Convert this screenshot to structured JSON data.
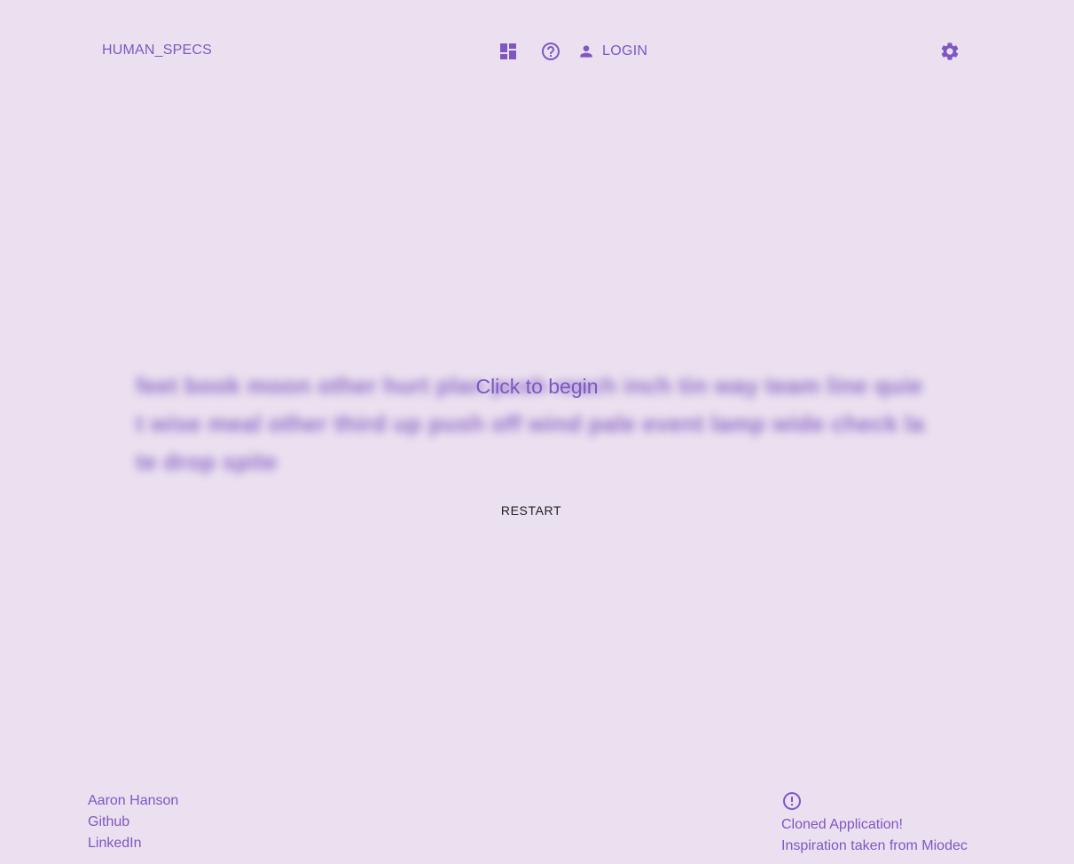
{
  "header": {
    "logo_text": "HUMAN_SPECS",
    "login_label": "LOGIN",
    "icons": {
      "dashboard": "dashboard-icon",
      "help": "help-circle-icon",
      "user": "person-icon",
      "settings": "gear-icon"
    }
  },
  "main": {
    "words": "feet book moon other hurt plan push reach inch tin way team line quiet wise meal other third up push off wind pale event lamp wide check late drop spite",
    "overlay_text": "Click to begin",
    "restart_label": "RESTART"
  },
  "footer": {
    "left": {
      "author": "Aaron Hanson",
      "github": "Github",
      "linkedin": "LinkedIn"
    },
    "right": {
      "icon": "alert-circle-icon",
      "line1": "Cloned Application!",
      "line2": "Inspiration taken from Miodec"
    }
  },
  "colors": {
    "background": "#ebe0ef",
    "accent": "#7e57c2",
    "text_dark": "#1f1f1f"
  }
}
